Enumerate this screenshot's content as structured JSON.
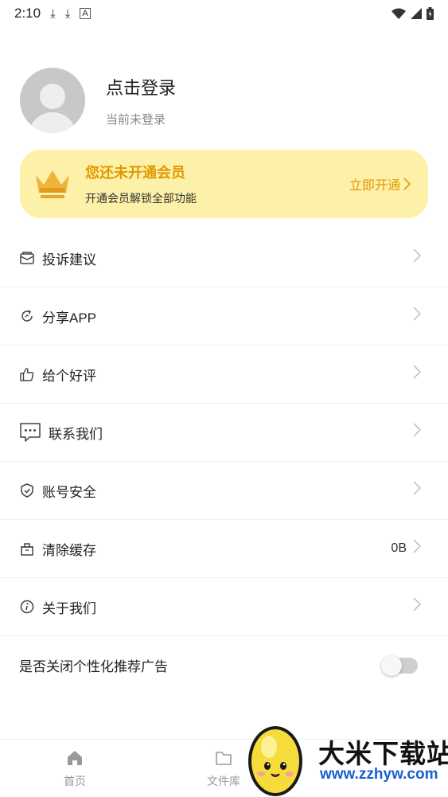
{
  "status_bar": {
    "time": "2:10",
    "icons": [
      "download-icon",
      "download-icon",
      "a-icon"
    ],
    "right_icons": [
      "wifi-icon",
      "signal-icon",
      "battery-icon"
    ]
  },
  "profile": {
    "title": "点击登录",
    "subtitle": "当前未登录"
  },
  "vip": {
    "title": "您还未开通会员",
    "subtitle": "开通会员解锁全部功能",
    "button": "立即开通",
    "accent_color": "#e09a00",
    "card_color": "#fdf0a8"
  },
  "menu": {
    "items": [
      {
        "label": "投诉建议",
        "icon": "mail-icon"
      },
      {
        "label": "分享APP",
        "icon": "refresh-share-icon"
      },
      {
        "label": "给个好评",
        "icon": "thumbs-up-icon"
      },
      {
        "label": "联系我们",
        "icon": "chat-icon"
      },
      {
        "label": "账号安全",
        "icon": "shield-icon"
      },
      {
        "label": "清除缓存",
        "icon": "basket-icon",
        "value": "0B"
      },
      {
        "label": "关于我们",
        "icon": "info-icon"
      }
    ],
    "toggle_label": "是否关闭个性化推荐广告",
    "toggle_on": false
  },
  "nav": {
    "items": [
      {
        "label": "首页",
        "icon": "home-icon"
      },
      {
        "label": "文件库",
        "icon": "folder-icon"
      }
    ]
  },
  "watermark": {
    "text": "大米下载站",
    "url": "www.zzhyw.com"
  }
}
